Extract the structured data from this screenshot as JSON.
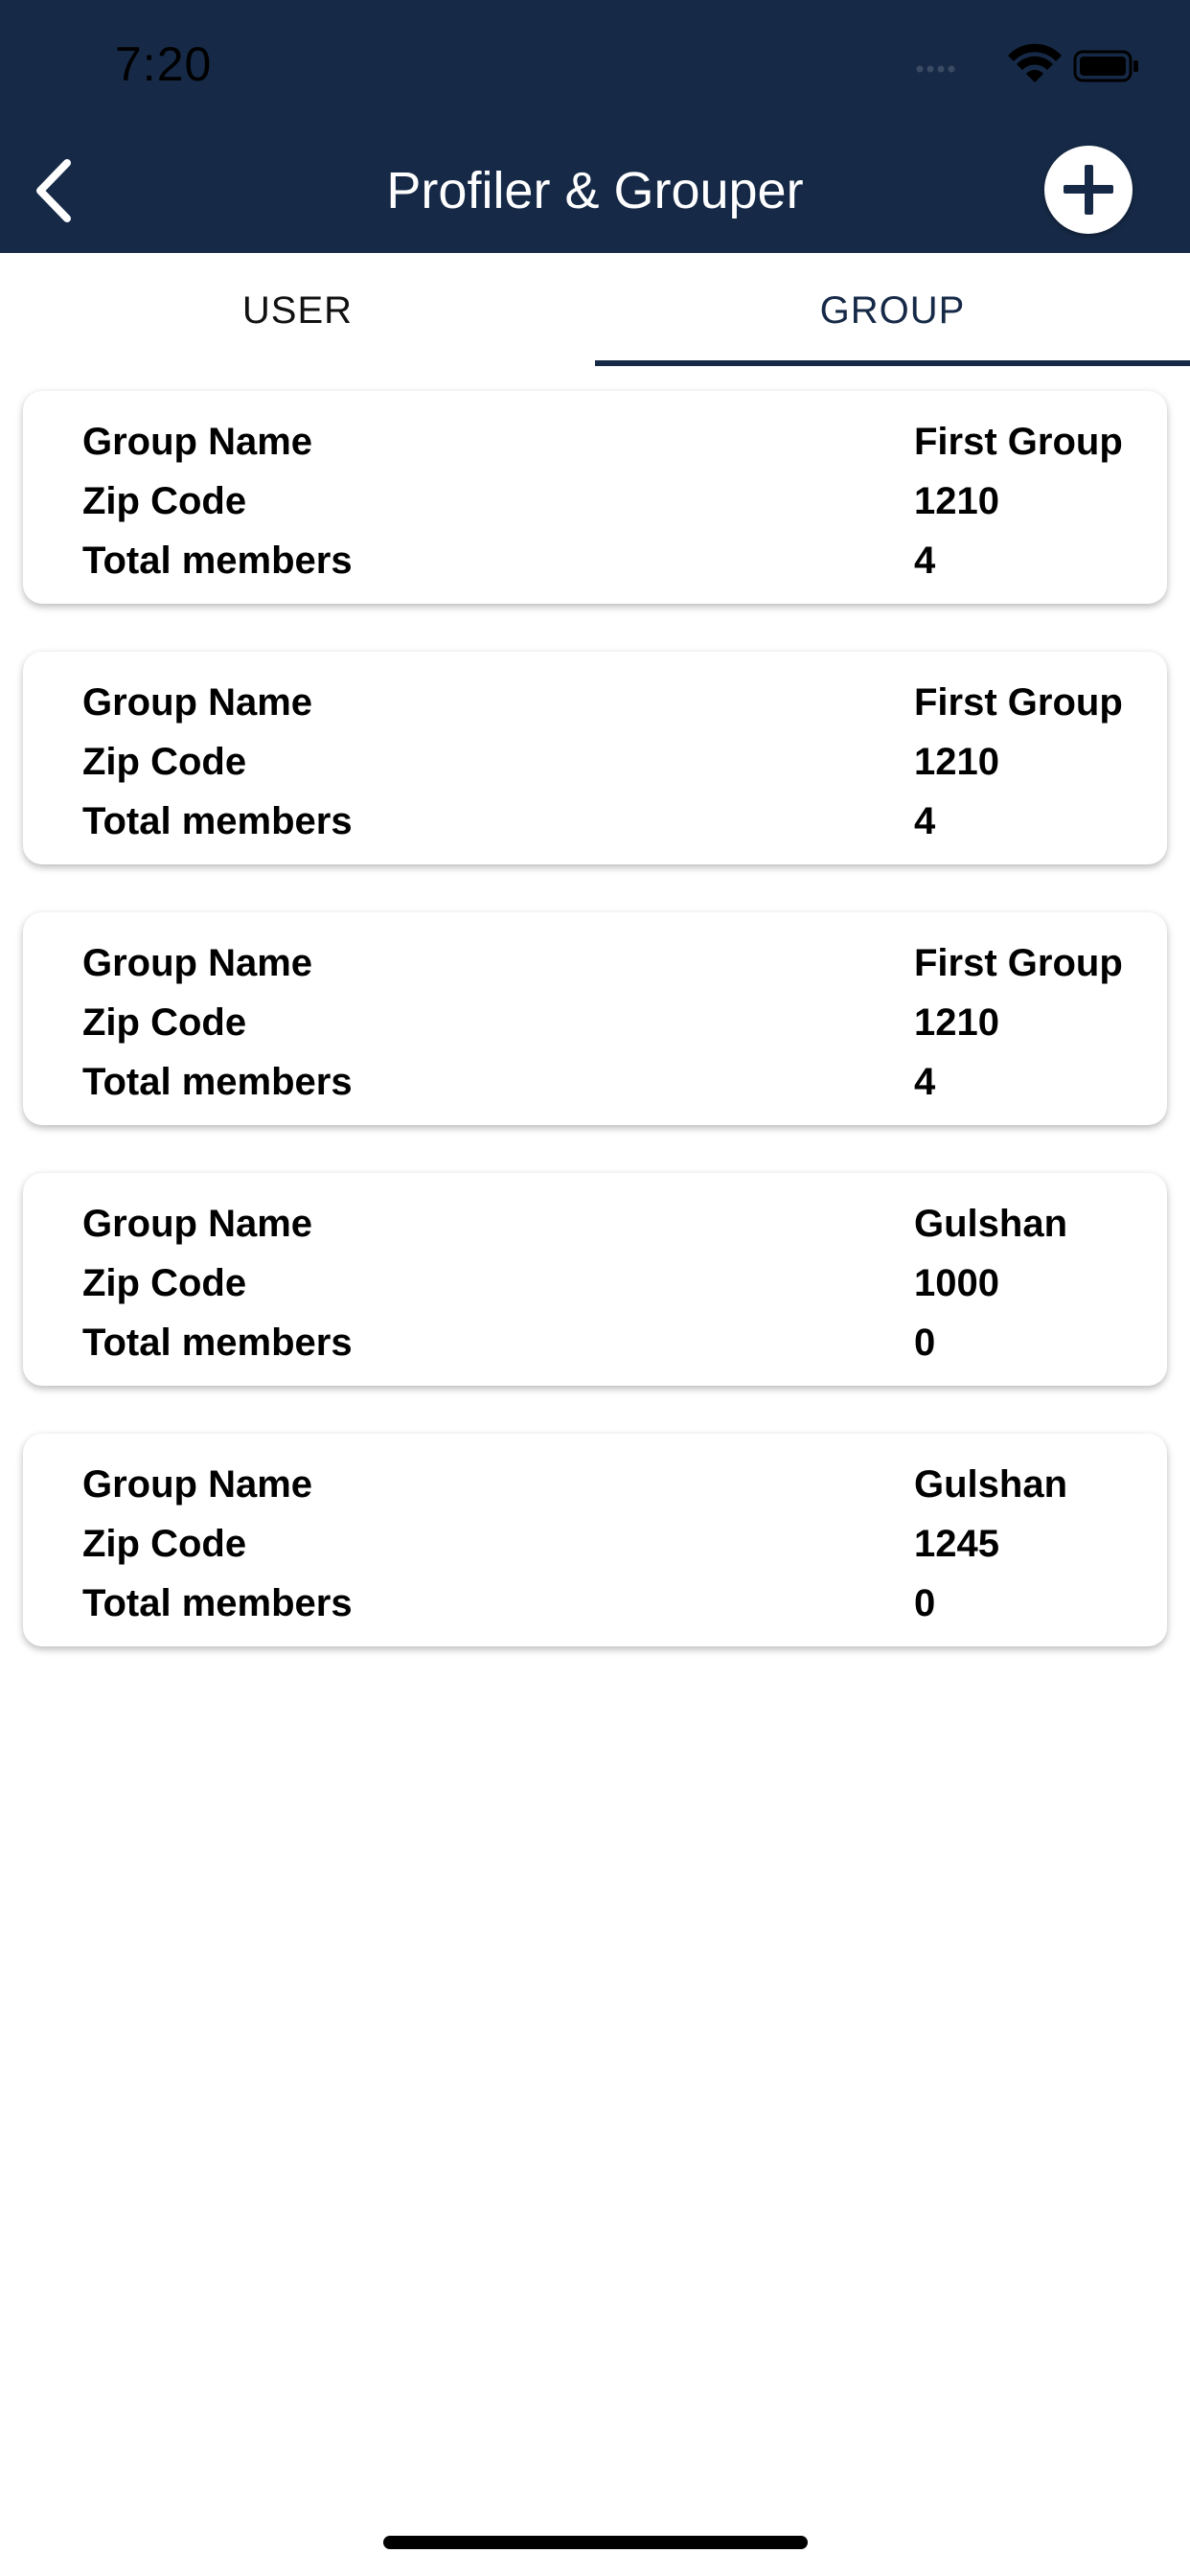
{
  "status_bar": {
    "time": "7:20",
    "icons": [
      "signal-icon",
      "wifi-icon",
      "battery-icon"
    ]
  },
  "header": {
    "title": "Profiler & Grouper",
    "back_icon": "chevron-left-icon",
    "add_icon": "plus-circle-icon",
    "background_color": "#162a47"
  },
  "tabs": [
    {
      "label": "USER",
      "active": false
    },
    {
      "label": "GROUP",
      "active": true
    }
  ],
  "labels": {
    "group_name": "Group Name",
    "zip_code": "Zip Code",
    "total_members": "Total members"
  },
  "groups": [
    {
      "group_name": "First Group",
      "zip_code": "1210",
      "total_members": "4"
    },
    {
      "group_name": "First Group",
      "zip_code": "1210",
      "total_members": "4"
    },
    {
      "group_name": "First Group",
      "zip_code": "1210",
      "total_members": "4"
    },
    {
      "group_name": "Gulshan",
      "zip_code": "1000",
      "total_members": "0"
    },
    {
      "group_name": "Gulshan",
      "zip_code": "1245",
      "total_members": "0"
    }
  ]
}
